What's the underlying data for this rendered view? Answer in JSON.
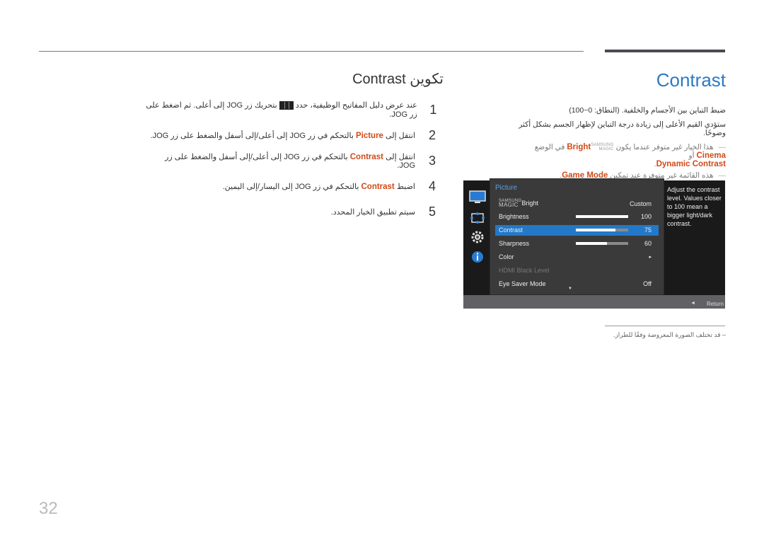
{
  "header": {
    "title_en": "Contrast",
    "title_ar": "تكوين Contrast"
  },
  "steps": [
    {
      "num": "1",
      "pre": "عند عرض دليل المفاتيح الوظيفية، حدد",
      "icon": "jog-menu-icon",
      "post": "بتحريك زر JOG إلى أعلى. ثم اضغط على زر JOG."
    },
    {
      "num": "2",
      "pre": "انتقل إلى",
      "hl": "Picture",
      "post": "بالتحكم في زر JOG إلى أعلى/إلى أسفل والضغط على زر JOG."
    },
    {
      "num": "3",
      "pre": "انتقل إلى",
      "hl": "Contrast",
      "post": "بالتحكم في زر JOG إلى أعلى/إلى أسفل والضغط على زر JOG."
    },
    {
      "num": "4",
      "pre": "اضبط",
      "hl": "Contrast",
      "post": "بالتحكم في زر JOG إلى اليسار/إلى اليمين."
    },
    {
      "num": "5",
      "pre": "سيتم تطبيق الخيار المحدد.",
      "hl": "",
      "post": ""
    }
  ],
  "description": {
    "line1": "ضبط التباين بين الأجسام والخلفية. (النطاق: 0~100)",
    "line2": "ستؤدي القيم الأعلى إلى زيادة درجة التباين لإظهار الجسم بشكل أكثر وضوحًا.",
    "note1_pre": "هذا الخيار غير متوفر عندما يكون",
    "note1_brand_top": "SAMSUNG",
    "note1_brand_bottom": "MAGIC",
    "note1_bright": "Bright",
    "note1_mid": "في الوضع",
    "note1_cinema": "Cinema",
    "note1_or": "أو",
    "note1_dynamic": "Dynamic Contrast",
    "note2_pre": "هذه القائمة غير متوفرة عند تمكين",
    "note2_hl": "Game Mode"
  },
  "osd": {
    "menu_title": "Picture",
    "rows": [
      {
        "label": "Bright",
        "brand_top": "SAMSUNG",
        "brand_bottom": "MAGIC",
        "value": "Custom"
      },
      {
        "label": "Brightness",
        "value": "100",
        "slider": 1.0
      },
      {
        "label": "Contrast",
        "value": "75",
        "slider": 0.75,
        "selected": true
      },
      {
        "label": "Sharpness",
        "value": "60",
        "slider": 0.6
      },
      {
        "label": "Color",
        "value": "▸"
      },
      {
        "label": "HDMI Black Level",
        "value": "",
        "disabled": true
      },
      {
        "label": "Eye Saver Mode",
        "value": "Off"
      }
    ],
    "tooltip": "Adjust the contrast level. Values closer to 100 mean a bigger light/dark contrast.",
    "return_label": "Return",
    "side_icons": [
      "picture-icon",
      "onscreen-display-icon",
      "setup-gear-icon",
      "information-icon"
    ]
  },
  "footnote": "– قد تختلف الصورة المعروضة وفقًا للطراز.",
  "page_number": "32",
  "colors": {
    "accent_blue": "#2a7bc5",
    "highlight_orange": "#d04a17",
    "osd_selected": "#2378c8"
  }
}
